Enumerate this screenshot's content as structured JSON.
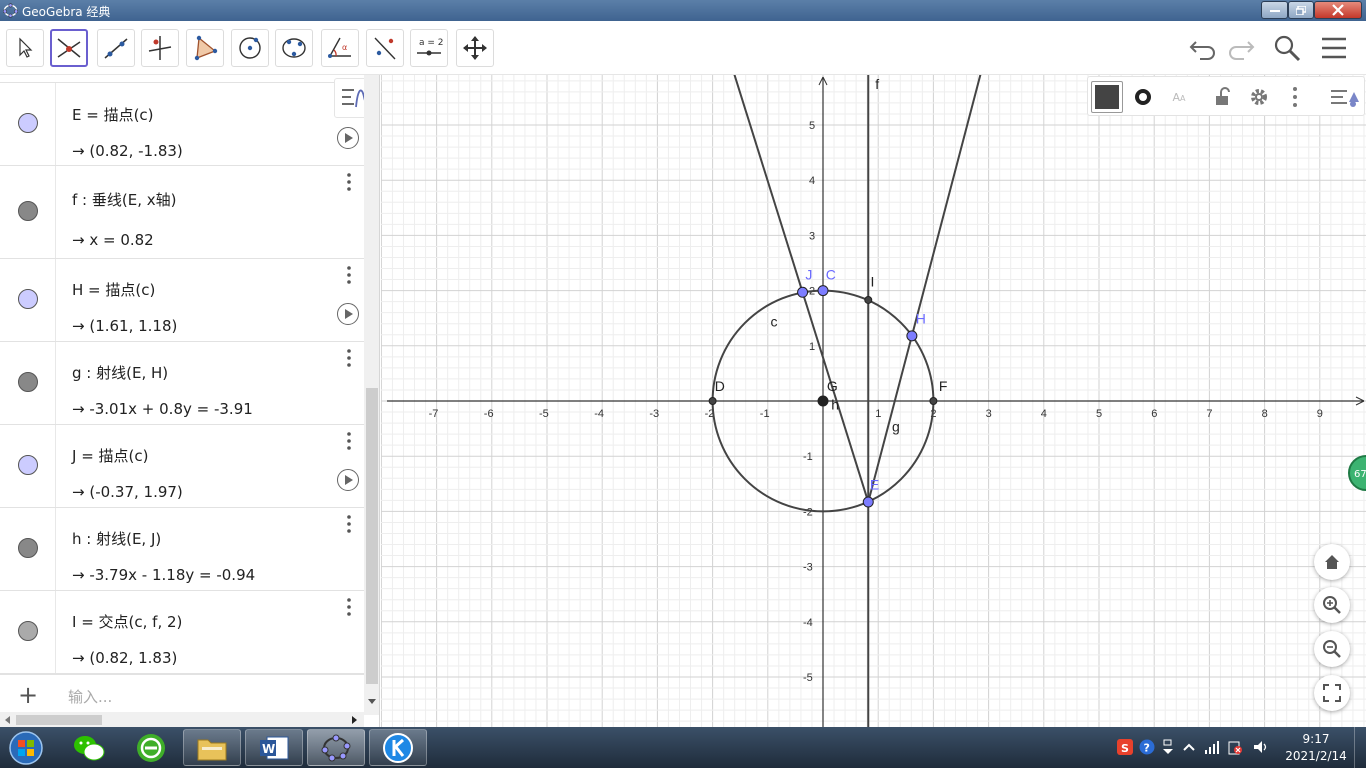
{
  "window": {
    "title": "GeoGebra 经典"
  },
  "toolbar": {
    "tools": [
      "move",
      "point",
      "line",
      "perpendicular-line",
      "polygon",
      "circle-center-point",
      "conic-through-points",
      "angle",
      "reflect",
      "slider",
      "move-graphics-view"
    ],
    "slider_label": "a = 2"
  },
  "algebra": {
    "rows": [
      {
        "def": "E = 描点(c)",
        "val": "→  (0.82, -1.83)",
        "color": "#ccccff",
        "anim": true
      },
      {
        "def": "f : 垂线(E, x轴)",
        "val": "→  x = 0.82",
        "color": "#888888",
        "anim": false
      },
      {
        "def": "H = 描点(c)",
        "val": "→  (1.61, 1.18)",
        "color": "#ccccff",
        "anim": true
      },
      {
        "def": "g : 射线(E, H)",
        "val": "→  -3.01x + 0.8y = -3.91",
        "color": "#888888",
        "anim": false
      },
      {
        "def": "J = 描点(c)",
        "val": "→  (-0.37, 1.97)",
        "color": "#ccccff",
        "anim": true
      },
      {
        "def": "h : 射线(E, J)",
        "val": "→  -3.79x - 1.18y = -0.94",
        "color": "#888888",
        "anim": false
      },
      {
        "def": "I = 交点(c, f, 2)",
        "val": "→  (0.82, 1.83)",
        "color": "#aaaaaa",
        "anim": false
      }
    ],
    "input_placeholder": "输入..."
  },
  "graphics": {
    "x_ticks": [
      "-7",
      "-6",
      "-5",
      "-4",
      "-3",
      "-2",
      "-1",
      "0",
      "1",
      "2",
      "3",
      "4",
      "5",
      "6",
      "7",
      "8",
      "9"
    ],
    "y_ticks": [
      "5",
      "4",
      "3",
      "2",
      "1",
      "-1",
      "-2",
      "-3",
      "-4",
      "-5"
    ],
    "labels": {
      "f": "f",
      "c": "c",
      "g": "g",
      "h": "h",
      "C": "C",
      "D": "D",
      "F": "F",
      "G": "G",
      "E": "E",
      "H": "H",
      "I": "I",
      "J": "J"
    },
    "points": {
      "C": [
        0,
        2
      ],
      "D": [
        -2,
        0
      ],
      "F": [
        2,
        0
      ],
      "G": [
        0,
        0
      ],
      "E": [
        0.82,
        -1.83
      ],
      "H": [
        1.61,
        1.18
      ],
      "J": [
        -0.37,
        1.97
      ],
      "I": [
        0.82,
        1.83
      ]
    },
    "circle_radius": 2,
    "badge": "67"
  },
  "taskbar": {
    "time": "9:17",
    "date": "2021/2/14"
  }
}
